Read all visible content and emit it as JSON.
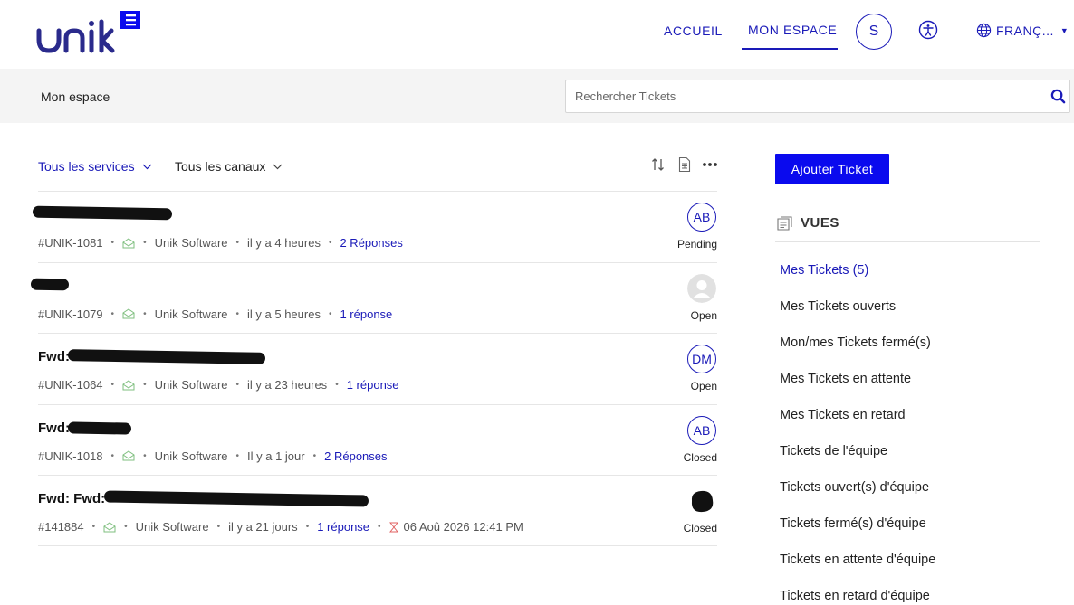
{
  "header": {
    "logo_text": "unik",
    "nav": {
      "home": "ACCUEIL",
      "my_space": "MON ESPACE"
    },
    "user_initial": "S",
    "language": "FRANÇ..."
  },
  "subbar": {
    "breadcrumb": "Mon espace",
    "search_placeholder": "Rechercher Tickets"
  },
  "filters": {
    "services": "Tous les services",
    "channels": "Tous les canaux"
  },
  "tickets": [
    {
      "title_prefix": "",
      "id": "#UNIK-1081",
      "company": "Unik Software",
      "time": "il y a 4 heures",
      "replies": "2 Réponses",
      "avatar": "AB",
      "status": "Pending",
      "due": ""
    },
    {
      "title_prefix": "",
      "id": "#UNIK-1079",
      "company": "Unik Software",
      "time": "il y a 5 heures",
      "replies": "1 réponse",
      "avatar": "",
      "status": "Open",
      "due": ""
    },
    {
      "title_prefix": "Fwd: ",
      "id": "#UNIK-1064",
      "company": "Unik Software",
      "time": "il y a 23 heures",
      "replies": "1 réponse",
      "avatar": "DM",
      "status": "Open",
      "due": ""
    },
    {
      "title_prefix": "Fwd:",
      "id": "#UNIK-1018",
      "company": "Unik Software",
      "time": "Il y a 1 jour",
      "replies": "2 Réponses",
      "avatar": "AB",
      "status": "Closed",
      "due": ""
    },
    {
      "title_prefix": "Fwd: Fwd: ",
      "id": "#141884",
      "company": "Unik Software",
      "time": "il y a 21 jours",
      "replies": "1 réponse",
      "avatar": "",
      "status": "Closed",
      "due": "06 Aoû 2026 12:41 PM"
    }
  ],
  "sidebar": {
    "add_button": "Ajouter Ticket",
    "views_title": "VUES",
    "views": [
      "Mes Tickets (5)",
      "Mes Tickets ouverts",
      "Mon/mes Tickets fermé(s)",
      "Mes Tickets en attente",
      "Mes Tickets en retard",
      "Tickets de l'équipe",
      "Tickets ouvert(s) d'équipe",
      "Tickets fermé(s) d'équipe",
      "Tickets en attente d'équipe",
      "Tickets en retard d'équipe"
    ]
  },
  "colors": {
    "brand": "#1a1ab8",
    "button": "#0a0aee",
    "subbar_bg": "#f4f4f4"
  },
  "icons": [
    "unik-logo-icon",
    "accessibility-icon",
    "globe-icon",
    "search-icon",
    "sort-icon",
    "export-icon",
    "more-icon",
    "mail-icon",
    "hourglass-icon",
    "vues-icon"
  ]
}
